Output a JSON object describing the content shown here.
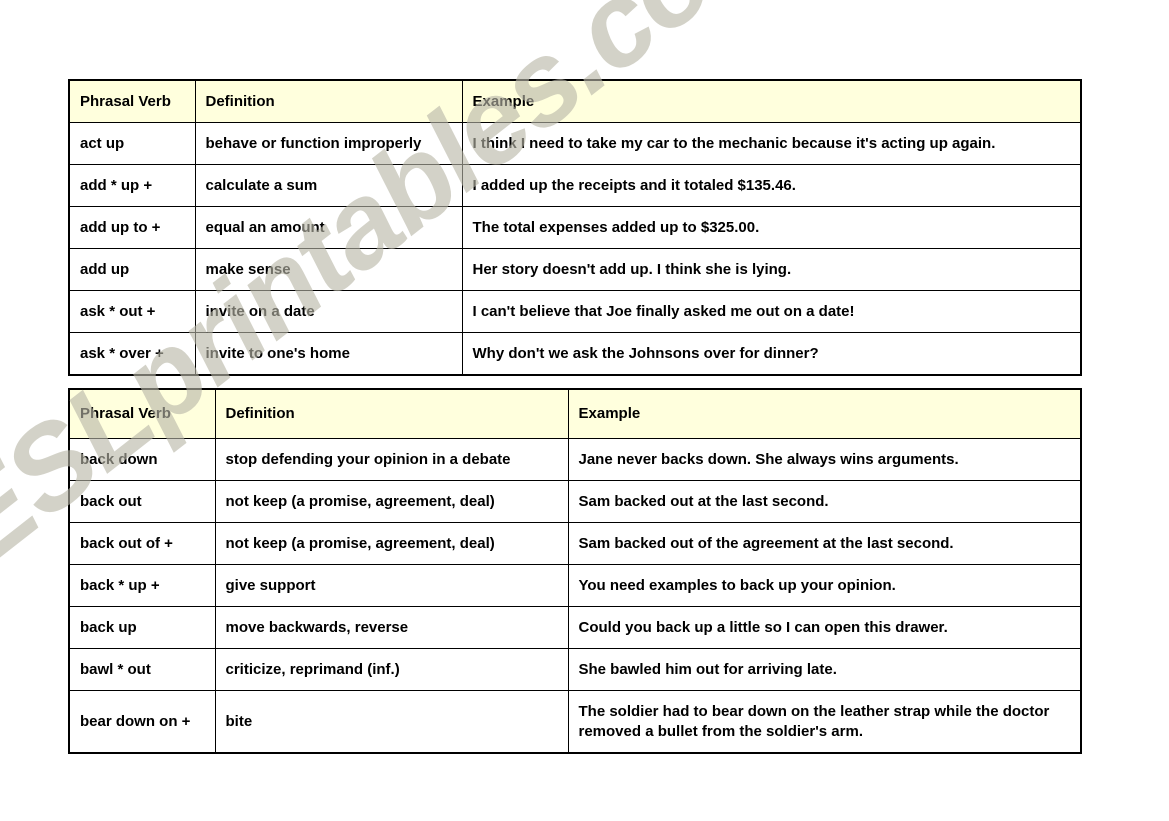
{
  "page": {
    "background_color": "#ffffff",
    "header_fill": "#ffffdd",
    "border_color": "#000000",
    "text_color": "#000000"
  },
  "watermark": {
    "text": "ESLprintables.com",
    "color": "#b9b7a8",
    "rotation_deg": -38
  },
  "tables": [
    {
      "id": "table-1",
      "columns": [
        "Phrasal Verb",
        "Definition",
        "Example"
      ],
      "rows": [
        {
          "verb": "act up",
          "definition": "behave or function improperly",
          "example": "I think I need to take my car to the mechanic because it's acting up again."
        },
        {
          "verb": "add * up +",
          "definition": "calculate a sum",
          "example": "I added up the receipts and it totaled $135.46."
        },
        {
          "verb": "add up to +",
          "definition": "equal an amount",
          "example": "The total expenses added up to $325.00."
        },
        {
          "verb": "add up",
          "definition": "make sense",
          "example": "Her story doesn't add up. I think she is lying."
        },
        {
          "verb": "ask * out +",
          "definition": "invite on a date",
          "example": "I can't believe that Joe finally asked me out on a date!"
        },
        {
          "verb": "ask * over +",
          "definition": "invite to one's home",
          "example": "Why don't we ask the Johnsons over for dinner?"
        }
      ]
    },
    {
      "id": "table-2",
      "columns": [
        "Phrasal Verb",
        "Definition",
        "Example"
      ],
      "rows": [
        {
          "verb": "back down",
          "definition": "stop defending your opinion in a debate",
          "example": "Jane never backs down. She always wins arguments."
        },
        {
          "verb": "back out",
          "definition": "not keep (a promise, agreement, deal)",
          "example": "Sam backed out at the last second."
        },
        {
          "verb": "back out of +",
          "definition": "not keep (a promise, agreement, deal)",
          "example": "Sam backed out of the agreement at the last second."
        },
        {
          "verb": "back * up +",
          "definition": "give support",
          "example": "You need examples to back up your opinion."
        },
        {
          "verb": "back up",
          "definition": "move backwards, reverse",
          "example": "Could you back up a little so I can open this drawer."
        },
        {
          "verb": "bawl * out",
          "definition": "criticize, reprimand (inf.)",
          "example": "She bawled him out for arriving late."
        },
        {
          "verb": "bear down on +",
          "definition": "bite",
          "example": "The soldier had to bear down on the leather strap while the doctor removed a bullet from the soldier's arm."
        }
      ]
    }
  ]
}
